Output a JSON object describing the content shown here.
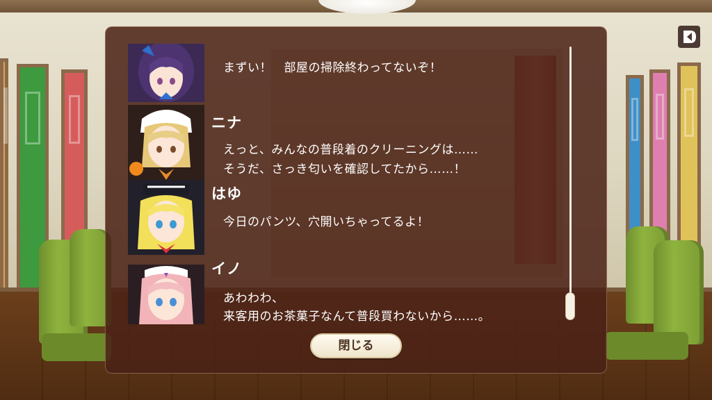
{
  "log": {
    "entries": [
      {
        "speaker": "",
        "lines": [
          "まずい！　部屋の掃除終わってないぞ！"
        ],
        "portrait": "purple-hair-girl-portrait"
      },
      {
        "speaker": "ニナ",
        "lines": [
          "えっと、みんなの普段着のクリーニングは……",
          "そうだ、さっき匂いを確認してたから……！"
        ],
        "portrait": "blonde-nun-girl-portrait"
      },
      {
        "speaker": "はゆ",
        "lines": [
          "今日のパンツ、穴開いちゃってるよ！"
        ],
        "portrait": "yellow-hair-girl-portrait"
      },
      {
        "speaker": "イノ",
        "lines": [
          "あわわわ、",
          "来客用のお茶菓子なんて普段買わないから……。"
        ],
        "portrait": "pink-hair-maid-girl-portrait"
      }
    ],
    "scroll_position": 0.93
  },
  "close_label": "閉じる",
  "icons": {
    "back": "back-arrow-icon"
  },
  "colors": {
    "panel": "#4a2216",
    "button": "#fffaf0",
    "text": "#ffffff"
  }
}
